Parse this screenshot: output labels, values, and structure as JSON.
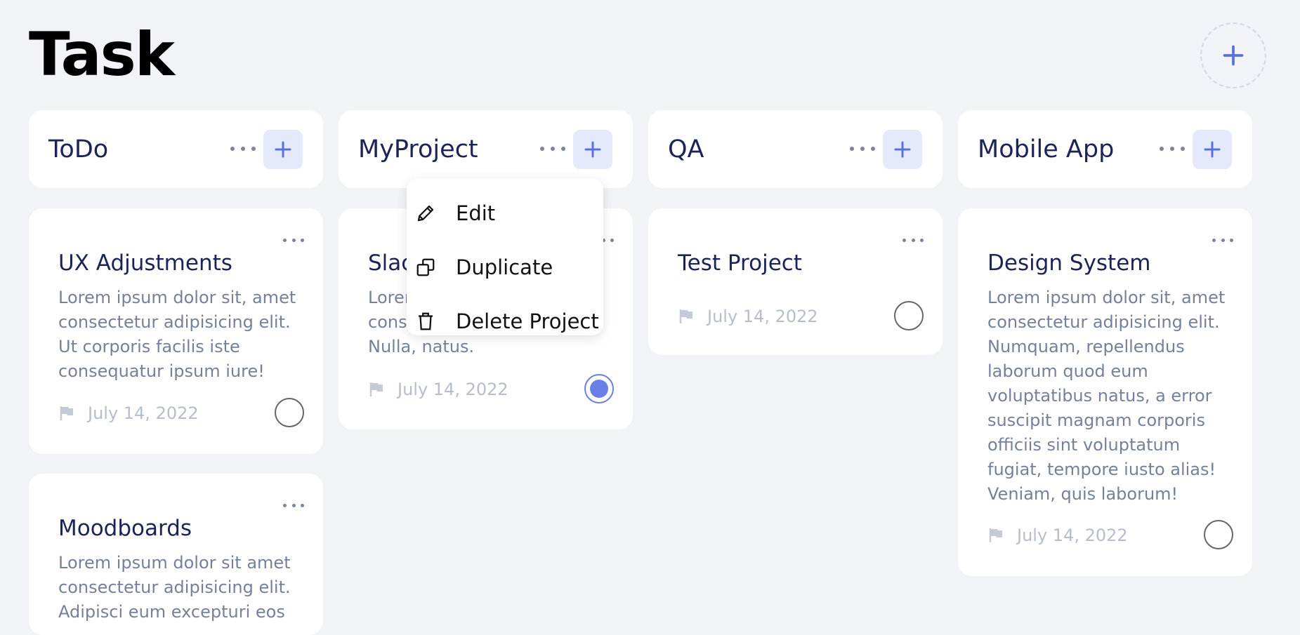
{
  "page": {
    "title": "Task"
  },
  "columns": [
    {
      "title": "ToDo",
      "cards": [
        {
          "title": "UX Adjustments",
          "description": "Lorem ipsum dolor sit, amet consectetur adipisicing elit. Ut corporis facilis iste consequatur ipsum iure!",
          "date": "July 14, 2022",
          "done": false
        },
        {
          "title": "Moodboards",
          "description": "Lorem ipsum dolor sit amet consectetur adipisicing elit. Adipisci eum excepturi eos",
          "date": "",
          "done": false
        }
      ]
    },
    {
      "title": "MyProject",
      "cards": [
        {
          "title": "Slack",
          "description": "Lorem ipsum dolor sit amet consectetur adipisicing elit. Nulla, natus.",
          "date": "July 14, 2022",
          "done": true
        }
      ]
    },
    {
      "title": "QA",
      "cards": [
        {
          "title": "Test Project",
          "description": "",
          "date": "July 14, 2022",
          "done": false
        }
      ]
    },
    {
      "title": "Mobile App",
      "cards": [
        {
          "title": "Design System",
          "description": "Lorem ipsum dolor sit, amet consectetur adipisicing elit. Numquam, repellendus laborum quod eum voluptatibus natus, a error suscipit magnam corporis officiis sint voluptatum fugiat, tempore iusto alias! Veniam, quis laborum!",
          "date": "July 14, 2022",
          "done": false
        }
      ]
    }
  ],
  "context_menu": {
    "items": [
      {
        "label": "Edit",
        "icon": "pencil-icon"
      },
      {
        "label": "Duplicate",
        "icon": "duplicate-icon"
      },
      {
        "label": "Delete Project",
        "icon": "trash-icon"
      }
    ]
  },
  "colors": {
    "accent": "#5b6fe0",
    "accent_soft": "#e4e9fc",
    "title": "#1c2457",
    "text_muted": "#75819a",
    "background": "#f2f3f7"
  }
}
